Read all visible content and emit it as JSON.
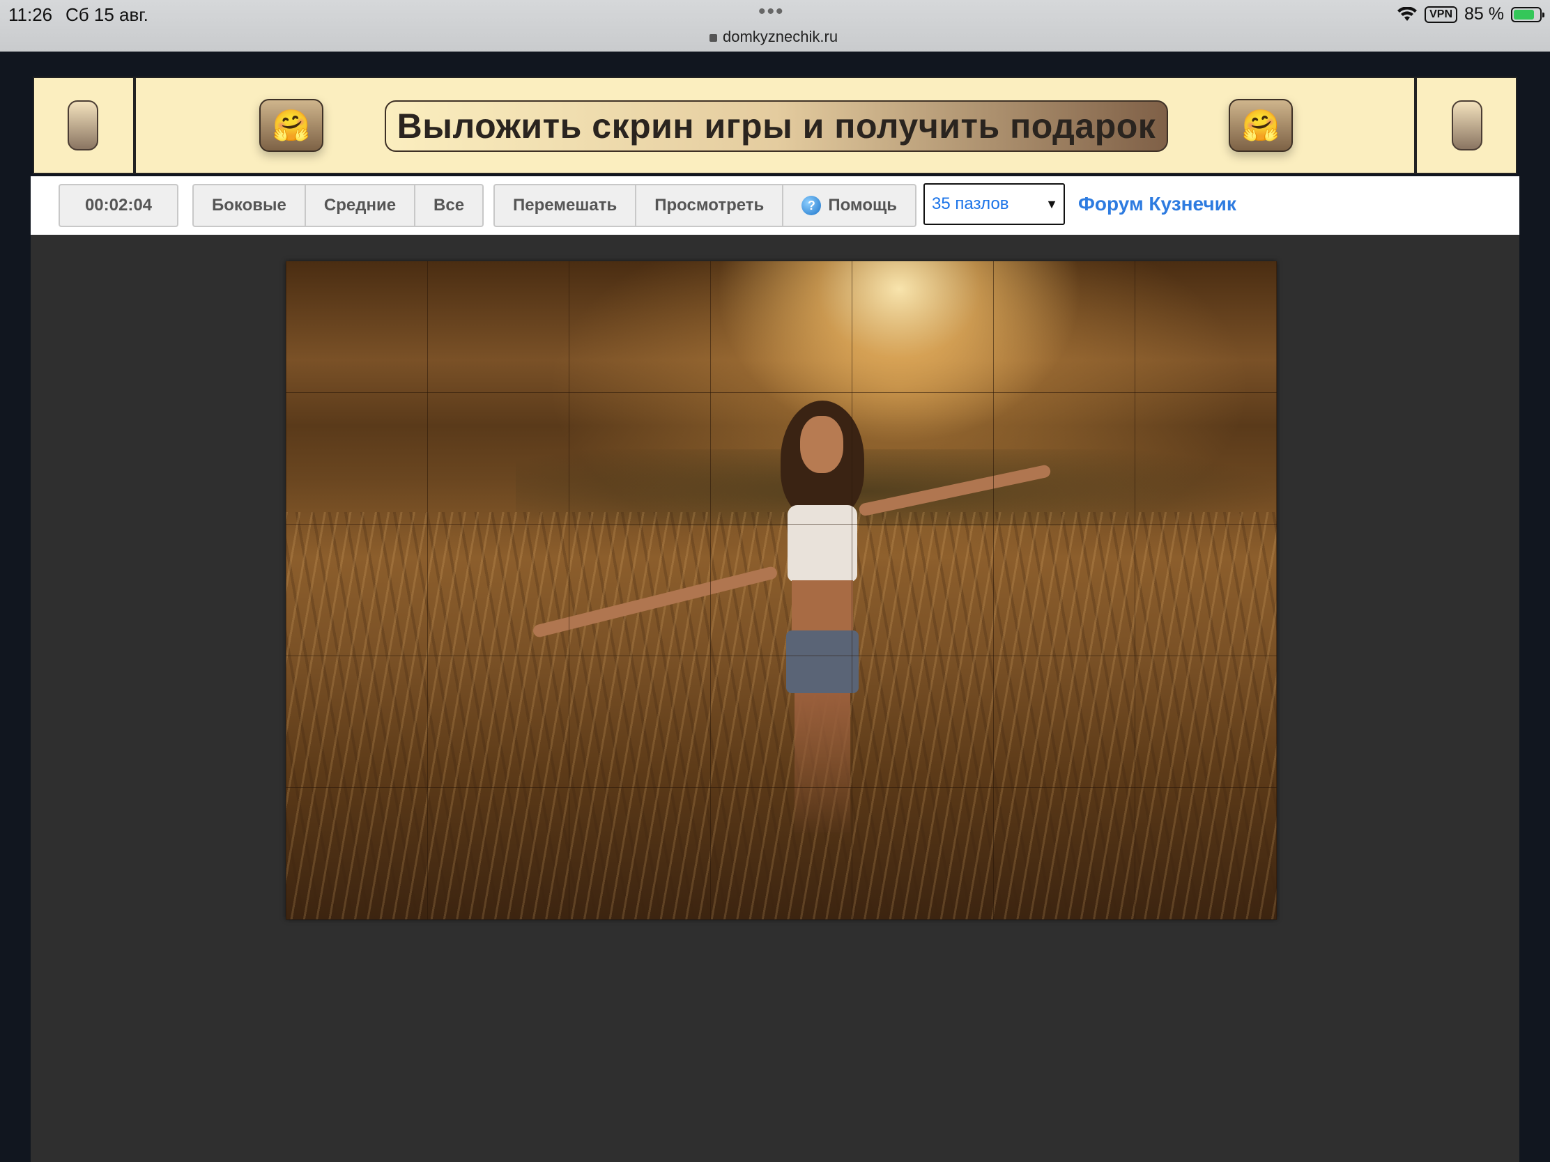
{
  "status_bar": {
    "time": "11:26",
    "date": "Сб 15 авг.",
    "url": "domkyznechik.ru",
    "vpn": "VPN",
    "battery": "85 %"
  },
  "banner": {
    "promo_text": "Выложить скрин игры и получить подарок",
    "emoji": "🤗"
  },
  "toolbar": {
    "timer": "00:02:04",
    "filter_buttons": [
      "Боковые",
      "Средние",
      "Все"
    ],
    "action_buttons": [
      "Перемешать",
      "Просмотреть",
      "Помощь"
    ],
    "help_icon": "?",
    "piece_count_select": "35 пазлов",
    "forum_link": "Форум Кузнечик"
  },
  "puzzle": {
    "pieces_total": 35,
    "columns": 7,
    "rows": 5,
    "image_subject": "girl-in-golden-field"
  },
  "colors": {
    "banner_bg": "#fbeebf",
    "link": "#2d7be0",
    "play_bg": "#2f2f2f",
    "page_bg": "#11161f"
  }
}
